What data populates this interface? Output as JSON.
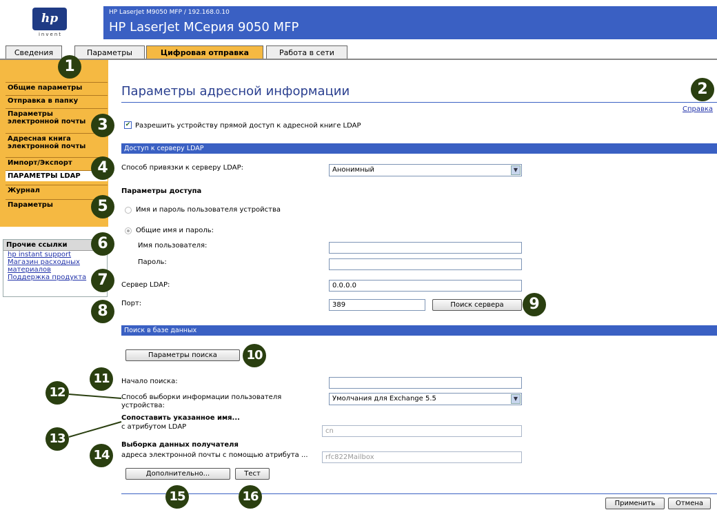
{
  "header": {
    "subtitle": "HP LaserJet M9050 MFP / 192.168.0.10",
    "title": "HP LaserJet MСерия 9050 MFP",
    "logo_text": "hp",
    "logo_sub": "invent"
  },
  "tabs": [
    {
      "label": "Сведения"
    },
    {
      "label": "Параметры"
    },
    {
      "label": "Цифровая отправка"
    },
    {
      "label": "Работа в сети"
    }
  ],
  "sidebar": {
    "items": [
      {
        "label": "Общие параметры"
      },
      {
        "label": "Отправка в папку"
      },
      {
        "label": "Параметры электронной почты"
      },
      {
        "label": "Адресная книга электронной почты"
      },
      {
        "label": "Импорт/Экспорт"
      },
      {
        "label": "ПАРАМЕТРЫ LDAP"
      },
      {
        "label": "Журнал"
      },
      {
        "label": "Параметры"
      }
    ],
    "other_links": {
      "title": "Прочие ссылки",
      "links": [
        "hp instant support",
        "Магазин расходных материалов",
        "Поддержка продукта"
      ]
    }
  },
  "main": {
    "page_title": "Параметры адресной информации",
    "help_link": "Справка",
    "allow_ldap_label": "Разрешить устройству прямой доступ к адресной книге LDAP",
    "ldap_section": {
      "title": "Доступ к серверу LDAP",
      "bind_label": "Способ привязки к серверу LDAP:",
      "bind_value": "Анонимный",
      "access_params": "Параметры доступа",
      "device_user_option": "Имя и пароль пользователя устройства",
      "common_option": "Общие имя и пароль:",
      "username_label": "Имя пользователя:",
      "password_label": "Пароль:",
      "server_label": "Сервер LDAP:",
      "server_value": "0.0.0.0",
      "port_label": "Порт:",
      "port_value": "389",
      "find_server_button": "Поиск сервера"
    },
    "db_section": {
      "title": "Поиск в базе данных",
      "search_params_button": "Параметры поиска",
      "search_root_label": "Начало поиска:",
      "retrieval_label_1": "Способ выборки информации пользователя",
      "retrieval_label_2": "устройства:",
      "retrieval_value": "Умолчания для Exchange 5.5",
      "match_name_label": "Сопоставить указанное имя...",
      "ldap_attr_label": "с атрибутом LDAP",
      "ldap_attr_value": "cn",
      "recipient_label": "Выборка данных получателя",
      "email_attr_label": "адреса электронной почты с помощью атрибута ...",
      "email_attr_value": "rfc822Mailbox",
      "advanced_button": "Дополнительно...",
      "test_button": "Тест"
    },
    "apply_button": "Применить",
    "cancel_button": "Отмена"
  },
  "callouts": [
    "1",
    "2",
    "3",
    "4",
    "5",
    "6",
    "7",
    "8",
    "9",
    "10",
    "11",
    "12",
    "13",
    "14",
    "15",
    "16"
  ],
  "colors": {
    "accent": "#3a60c3",
    "tab_active": "#f5b942",
    "callout": "#2a3f10"
  }
}
